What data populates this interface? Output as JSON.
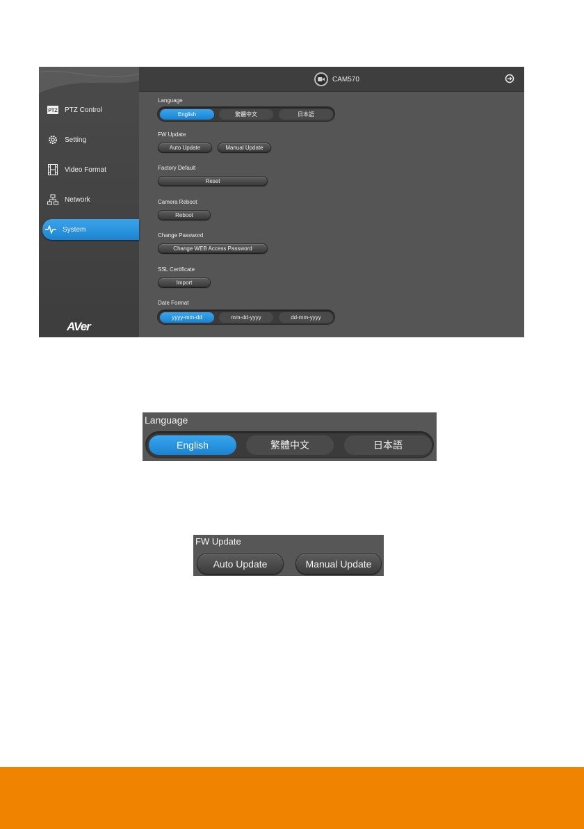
{
  "app": {
    "camera_name": "CAM570",
    "brand_logo": "AVer",
    "sidebar": {
      "items": [
        {
          "label": "PTZ Control",
          "icon": "ptz-icon",
          "active": false
        },
        {
          "label": "Setting",
          "icon": "gear-icon",
          "active": false
        },
        {
          "label": "Video Format",
          "icon": "film-icon",
          "active": false
        },
        {
          "label": "Network",
          "icon": "network-icon",
          "active": false
        },
        {
          "label": "System",
          "icon": "pulse-icon",
          "active": true
        }
      ]
    },
    "system": {
      "language": {
        "label": "Language",
        "options": [
          "English",
          "繁體中文",
          "日本語"
        ],
        "selected": "English"
      },
      "fw_update": {
        "label": "FW Update",
        "auto_label": "Auto Update",
        "manual_label": "Manual Update"
      },
      "factory_default": {
        "label": "Factory Default",
        "button": "Reset"
      },
      "camera_reboot": {
        "label": "Camera Reboot",
        "button": "Reboot"
      },
      "change_password": {
        "label": "Change Password",
        "button": "Change WEB Access Password"
      },
      "ssl_certificate": {
        "label": "SSL Certificate",
        "button": "Import"
      },
      "date_format": {
        "label": "Date Format",
        "options": [
          "yyyy-mm-dd",
          "mm-dd-yyyy",
          "dd-mm-yyyy"
        ],
        "selected": "yyyy-mm-dd"
      }
    }
  },
  "zoom_language": {
    "label": "Language",
    "options": [
      "English",
      "繁體中文",
      "日本語"
    ]
  },
  "zoom_fw": {
    "label": "FW Update",
    "auto_label": "Auto Update",
    "manual_label": "Manual Update"
  },
  "colors": {
    "accent_blue": "#2196e0",
    "panel_gray": "#555555",
    "footer_orange": "#f08300"
  }
}
